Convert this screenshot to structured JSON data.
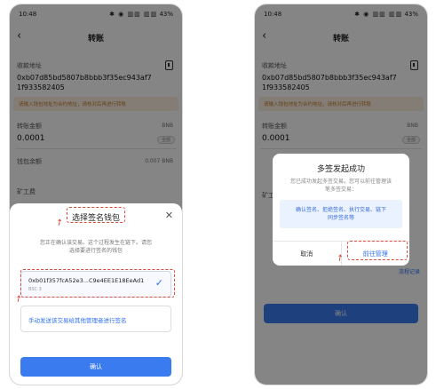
{
  "status": {
    "time": "10:48",
    "icons": "✱ ◉ ▥▥ ▥▥",
    "battery": "43%"
  },
  "transfer": {
    "title": "转账",
    "recipient_label": "收款地址",
    "recipient_address_line1": "0xb07d85bd5807b8bbb3f35ec943af7",
    "recipient_address_line2": "1f933582405",
    "warning": "请输入钱包地址为合约地址，请核对后再进行转账",
    "amount_label": "转账金额",
    "amount_value": "0.0001",
    "token": "BNB",
    "all_label": "全部",
    "balance_label": "钱包余额",
    "balance_value": "0.007 BNB",
    "fee_label": "矿工费"
  },
  "sheet": {
    "title": "选择签名钱包",
    "desc_line1": "您正在确认该交易。这个过程发生在链下。请您",
    "desc_line2": "选择要进行签名的钱包",
    "wallet_address": "0xb01f357fcA52e3...C9e4EE1E18EeAd1",
    "wallet_chain": "BSC·3",
    "manual_option": "手动发送该交易给其他管理者进行签名",
    "confirm": "确认"
  },
  "dialog": {
    "title": "多签发起成功",
    "desc_line1": "您已成功发起多签交易。您可以前往管理该",
    "desc_line2": "笔多签交易：",
    "steps_line1": "确认签名、拒绝签名、执行交易、链下",
    "steps_line2": "同步签名等",
    "cancel": "取消",
    "go": "前往管理",
    "behind_link": "流程记录",
    "confirm": "确认"
  },
  "colors": {
    "accent": "#3a7bf0",
    "annotation": "#d94a3a"
  }
}
